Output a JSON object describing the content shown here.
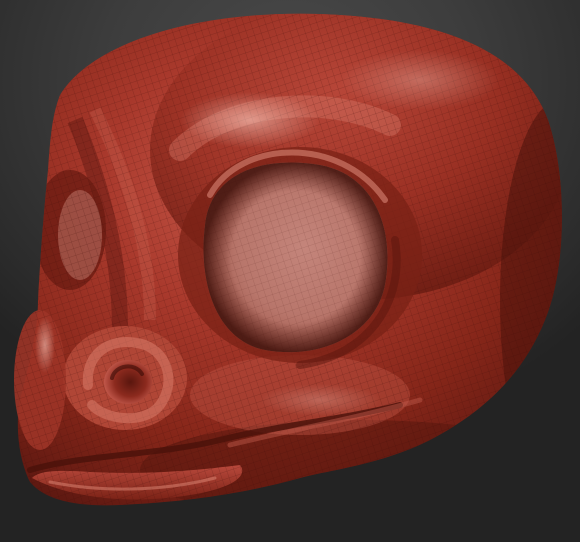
{
  "viewport": {
    "background": "#3a3a3a",
    "material_color": "#a8382c"
  },
  "model": {
    "name": "sculpted-creature-head",
    "display_mode": "wireframe-polyframe-overlay"
  }
}
